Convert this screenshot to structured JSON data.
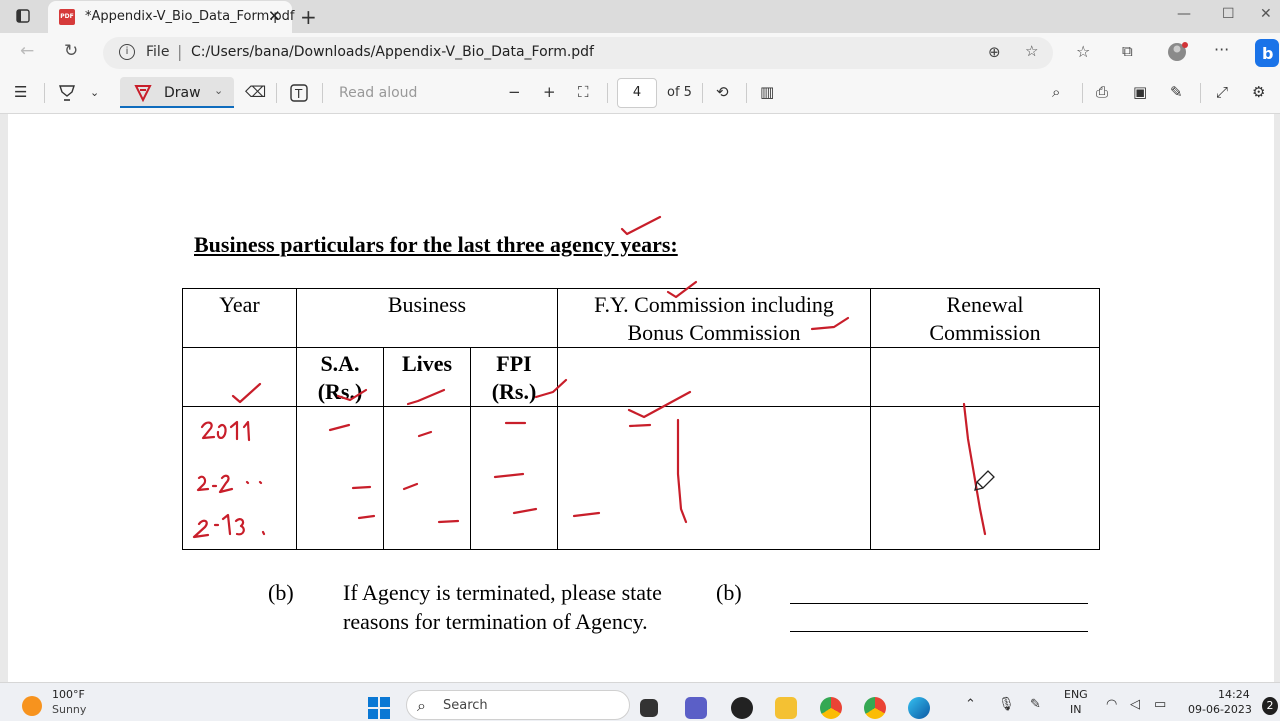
{
  "browser": {
    "tab_title": "*Appendix-V_Bio_Data_Form.pdf",
    "tab_close": "✕",
    "new_tab": "+",
    "address_prefix": "File",
    "address_url": "C:/Users/bana/Downloads/Appendix-V_Bio_Data_Form.pdf"
  },
  "pdf_toolbar": {
    "draw_label": "Draw",
    "read_aloud_label": "Read aloud",
    "current_page": "4",
    "page_of": "of 5"
  },
  "document": {
    "heading": "Business particulars for the last three agency years:",
    "table": {
      "col_year": "Year",
      "col_business": "Business",
      "col_fy_commission": "F.Y. Commission including Bonus Commission",
      "col_renewal": "Renewal Commission",
      "sub_sa": "S.A. (Rs.)",
      "sub_lives": "Lives",
      "sub_fpi": "FPI (Rs.)"
    },
    "item_b_label": "(b)",
    "item_b_text": "If Agency is terminated, please state reasons for termination of Agency.",
    "answer_b_label": "(b)"
  },
  "ink_color": "#c81e2a",
  "taskbar": {
    "temperature": "100°F",
    "weather": "Sunny",
    "search_label": "Search",
    "lang_top": "ENG",
    "lang_bottom": "IN",
    "time": "14:24",
    "date": "09-06-2023",
    "notification_count": "2"
  }
}
